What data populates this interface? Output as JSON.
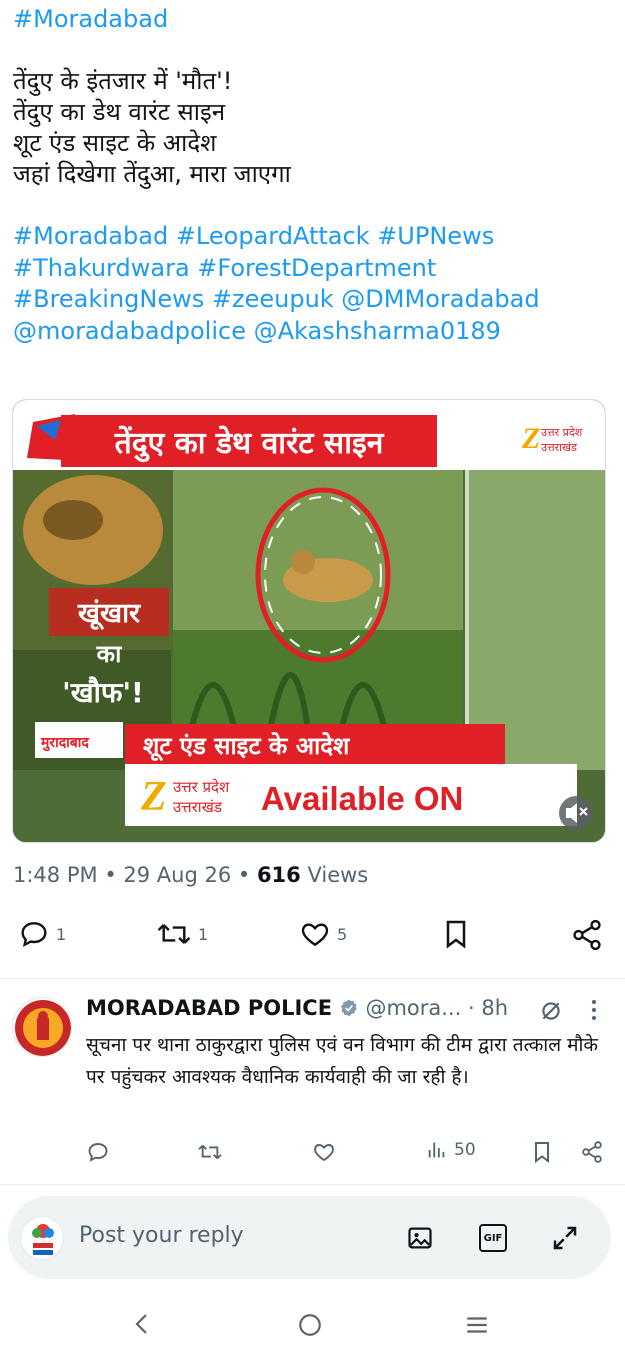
{
  "post": {
    "first_tag": "#Moradabad",
    "lines": [
      "तेंदुए के इंतजार में 'मौत'!",
      "तेंदुए का डेथ वारंट साइन",
      "शूट एंड साइट के आदेश",
      "जहां दिखेगा तेंदुआ, मारा जाएगा"
    ],
    "tag_lines": [
      "#Moradabad #LeopardAttack #UPNews",
      "#Thakurdwara #ForestDepartment",
      "#BreakingNews #zeeupuk @DMMoradabad",
      "@moradabadpolice @Akashsharma0189"
    ]
  },
  "media": {
    "headline": "तेंदुए का डेथ वारंट साइन",
    "channel_top": "उत्तर प्रदेश",
    "channel_bottom": "उत्तराखंड",
    "left_caption_1": "खूंखार",
    "left_caption_2": "का",
    "left_caption_3": "'खौफ'!",
    "location": "मुरादाबाद",
    "ticker": "शूट एंड साइट के आदेश",
    "available": "Available ON"
  },
  "meta": {
    "time": "1:48 PM",
    "date": "29 Aug 26",
    "views_count": "616",
    "views_label": "Views"
  },
  "actions": {
    "replies": "1",
    "reposts": "1",
    "likes": "5"
  },
  "reply": {
    "name": "MORADABAD POLICE",
    "handle": "@mora...",
    "time": "8h",
    "body": "सूचना पर थाना ठाकुरद्वारा पुलिस एवं वन विभाग की टीम द्वारा तत्काल मौके पर पहुंचकर आवश्यक वैधानिक कार्यवाही की जा रही है।",
    "views": "50"
  },
  "composer": {
    "placeholder": "Post your reply",
    "gif_label": "GIF"
  },
  "colors": {
    "accent": "#1d9bf0",
    "text": "#0f1419",
    "muted": "#536471",
    "headline_red": "#e01f26"
  }
}
